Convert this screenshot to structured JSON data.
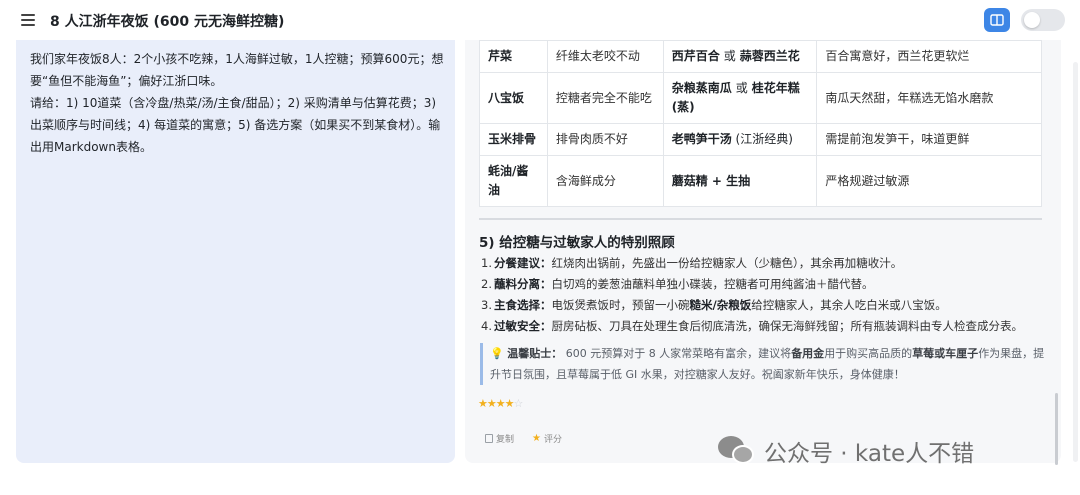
{
  "header": {
    "title": "8 人江浙年夜饭 (600 元无海鲜控糖)"
  },
  "prompt": {
    "line1": "我们家年夜饭8人：2个小孩不吃辣，1人海鲜过敏，1人控糖；预算600元；想要“鱼但不能海鱼”；偏好江浙口味。",
    "line2": "请给：1) 10道菜（含冷盘/热菜/汤/主食/甜品）；2) 采购清单与估算花费；3) 出菜顺序与时间线；4) 每道菜的寓意；5) 备选方案（如果买不到某食材）。输出用Markdown表格。"
  },
  "table": {
    "rows": [
      {
        "dish": "芹菜",
        "issue": "纤维太老咬不动",
        "alt_a": "西芹百合",
        "or": "或",
        "alt_b": "蒜蓉西兰花",
        "alt_suffix": "",
        "note": "百合寓意好，西兰花更软烂"
      },
      {
        "dish": "八宝饭",
        "issue": "控糖者完全不能吃",
        "alt_a": "杂粮蒸南瓜",
        "or": "或",
        "alt_b": "桂花年糕(蒸)",
        "alt_suffix": "",
        "note": "南瓜天然甜，年糕选无馅水磨款"
      },
      {
        "dish": "玉米排骨",
        "issue": "排骨肉质不好",
        "alt_a": "老鸭笋干汤",
        "or": "",
        "alt_b": "",
        "alt_suffix": " (江浙经典)",
        "note": "需提前泡发笋干，味道更鲜"
      },
      {
        "dish": "蚝油/酱油",
        "issue": "含海鲜成分",
        "alt_a": "蘑菇精 + 生抽",
        "or": "",
        "alt_b": "",
        "alt_suffix": "",
        "note": "严格规避过敏源"
      }
    ]
  },
  "section5": {
    "title": "5) 给控糖与过敏家人的特别照顾",
    "items": [
      {
        "num": "1.",
        "label": "分餐建议：",
        "text": "红烧肉出锅前，先盛出一份给控糖家人（少糖色），其余再加糖收汁。",
        "pre": "",
        "bold2": "",
        "post": ""
      },
      {
        "num": "2.",
        "label": "蘸料分离：",
        "text": "白切鸡的姜葱油蘸料单独小碟装，控糖者可用纯酱油＋醋代替。",
        "pre": "",
        "bold2": "",
        "post": ""
      },
      {
        "num": "3.",
        "label": "主食选择：",
        "text": "",
        "pre": "电饭煲煮饭时，预留一小碗",
        "bold2": "糙米/杂粮饭",
        "post": "给控糖家人，其余人吃白米或八宝饭。"
      },
      {
        "num": "4.",
        "label": "过敏安全：",
        "text": "厨房砧板、刀具在处理生食后彻底清洗，确保无海鲜残留；所有瓶装调料由专人检查成分表。",
        "pre": "",
        "bold2": "",
        "post": ""
      }
    ]
  },
  "note": {
    "label": "温馨贴士：",
    "p1": "600 元预算对于 8 人家常菜略有富余，建议将",
    "b1": "备用金",
    "p2": "用于购买高品质的",
    "b2": "草莓或车厘子",
    "p3": "作为果盘，提升节日氛围，且草莓属于低 GI 水果，对控糖家人友好。祝阖家新年快乐，身体健康！"
  },
  "rating": {
    "value": 4,
    "max": 5
  },
  "actions": {
    "copy": "复制",
    "rate": "评分"
  },
  "watermark": {
    "text": "公众号 · kate人不错"
  },
  "icons": {
    "menu": "menu-icon",
    "split": "split-view-icon",
    "bulb": "lightbulb-icon",
    "copy": "copy-icon",
    "rate": "star-icon",
    "wechat": "wechat-icon"
  },
  "colors": {
    "accent": "#3d86e6",
    "left_panel": "#e9eefa",
    "star": "#f2b01e"
  }
}
